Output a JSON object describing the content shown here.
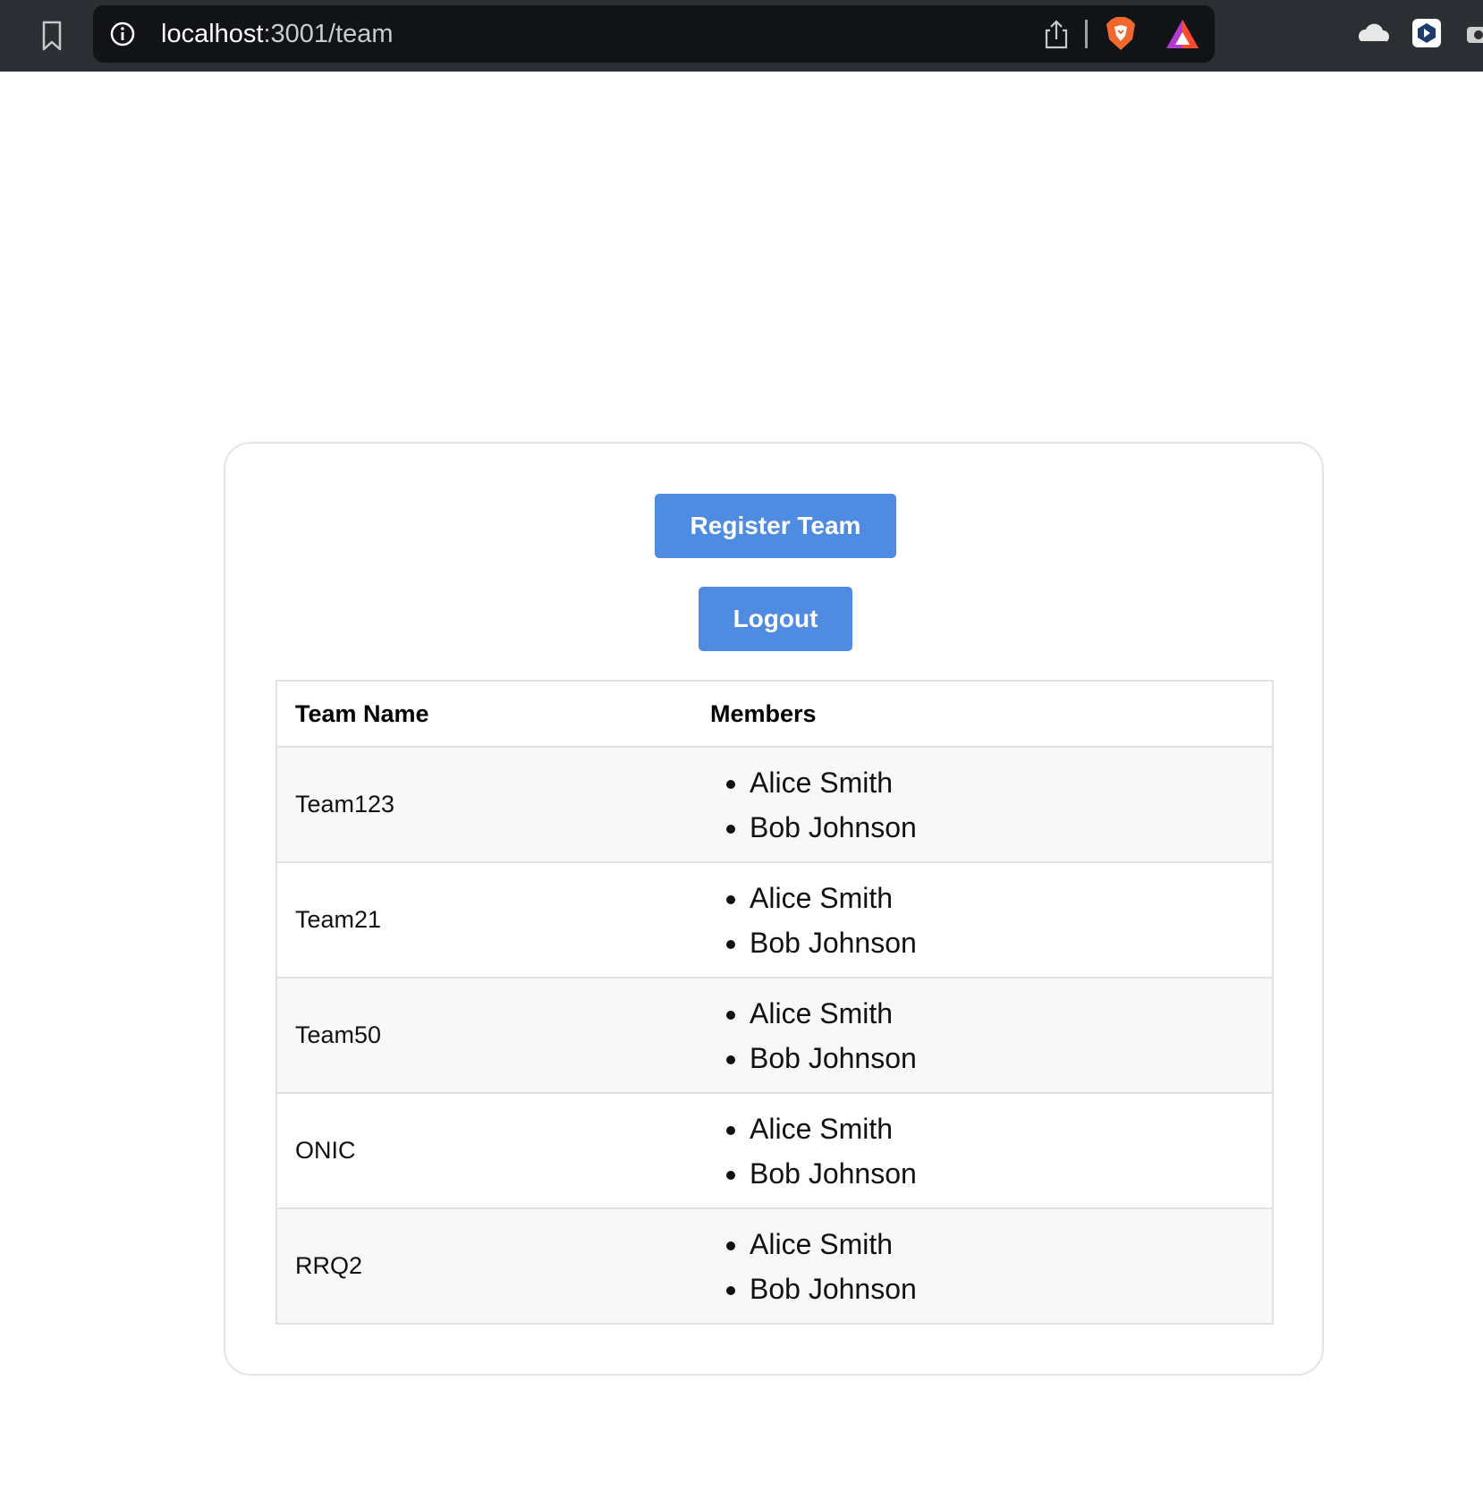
{
  "browser": {
    "url_host": "localhost",
    "url_path": ":3001/team"
  },
  "actions": {
    "register_label": "Register Team",
    "logout_label": "Logout"
  },
  "table": {
    "headers": [
      "Team Name",
      "Members"
    ],
    "rows": [
      {
        "team": "Team123",
        "members": [
          "Alice Smith",
          "Bob Johnson"
        ]
      },
      {
        "team": "Team21",
        "members": [
          "Alice Smith",
          "Bob Johnson"
        ]
      },
      {
        "team": "Team50",
        "members": [
          "Alice Smith",
          "Bob Johnson"
        ]
      },
      {
        "team": "ONIC",
        "members": [
          "Alice Smith",
          "Bob Johnson"
        ]
      },
      {
        "team": "RRQ2",
        "members": [
          "Alice Smith",
          "Bob Johnson"
        ]
      }
    ]
  },
  "colors": {
    "button": "#4f8be0",
    "row_shaded": "#f8f8f8",
    "browser_bar": "#2b2e33"
  }
}
